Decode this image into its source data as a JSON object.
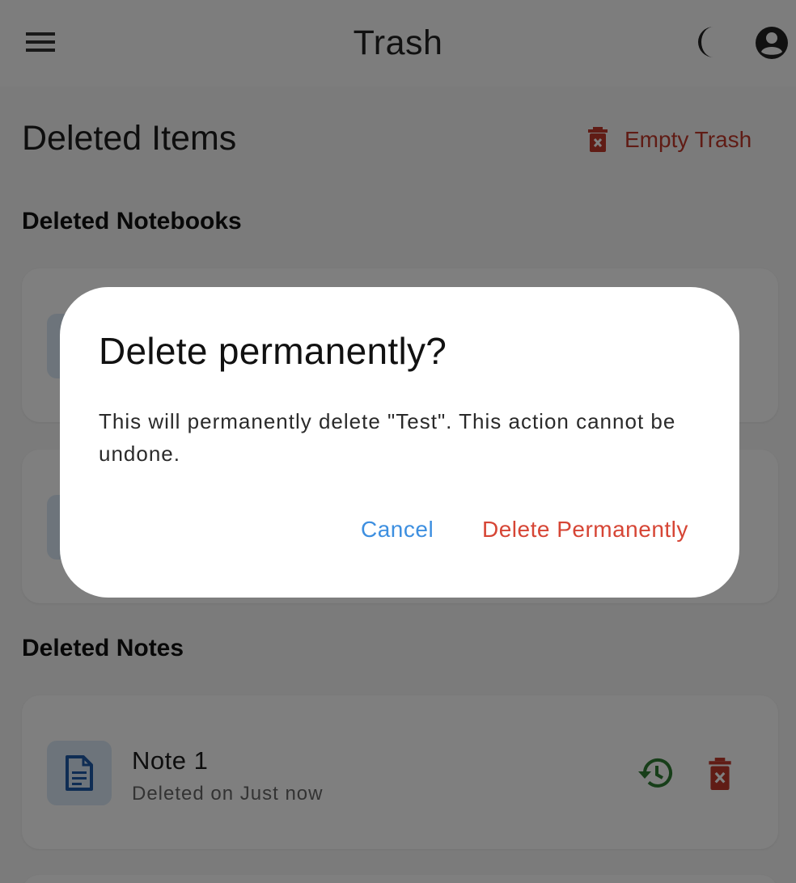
{
  "app_bar": {
    "title": "Trash",
    "menu_icon": "hamburger-menu-icon",
    "theme_icon": "moon-icon",
    "account_icon": "account-circle-icon"
  },
  "page": {
    "heading": "Deleted Items",
    "empty_trash_label": "Empty Trash",
    "empty_trash_icon": "trash-x-icon"
  },
  "sections": {
    "notebooks_title": "Deleted Notebooks",
    "notes_title": "Deleted Notes"
  },
  "notes": [
    {
      "title": "Note 1",
      "subtitle": "Deleted on Just now",
      "icon": "document-icon",
      "restore_icon": "restore-history-icon",
      "delete_icon": "trash-x-icon"
    }
  ],
  "dialog": {
    "title": "Delete permanently?",
    "body": "This will permanently delete \"Test\". This action cannot be undone.",
    "cancel_label": "Cancel",
    "confirm_label": "Delete Permanently"
  },
  "colors": {
    "accent_blue": "#3d8fe0",
    "danger_red": "#c0392b",
    "restore_green": "#2e7d32",
    "doc_blue": "#1e5aa8",
    "thumb_bg": "#dbe8f6"
  }
}
